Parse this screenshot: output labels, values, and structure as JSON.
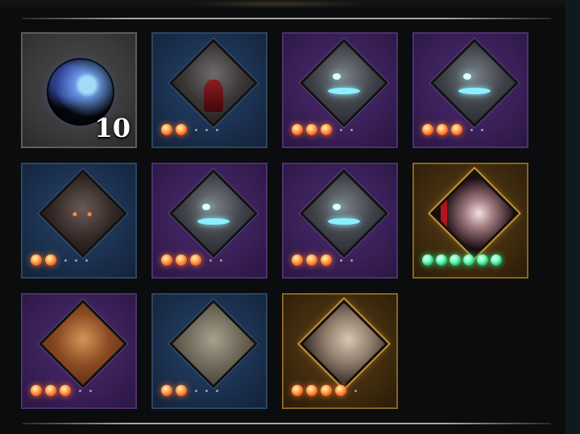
{
  "item": {
    "name_icon": "dark-blue-orb-icon",
    "quantity": "10"
  },
  "characters": [
    {
      "slot": 2,
      "frame": "blue",
      "portrait": "hooded-figure-portrait",
      "stars": 2,
      "star_color": "fire",
      "max_stars": 5
    },
    {
      "slot": 3,
      "frame": "purple",
      "portrait": "masked-figure-portrait",
      "stars": 3,
      "star_color": "fire",
      "max_stars": 5
    },
    {
      "slot": 4,
      "frame": "purple",
      "portrait": "masked-figure-portrait",
      "stars": 3,
      "star_color": "fire",
      "max_stars": 5
    },
    {
      "slot": 5,
      "frame": "blue",
      "portrait": "demon-faced-portrait",
      "stars": 2,
      "star_color": "fire",
      "max_stars": 5
    },
    {
      "slot": 6,
      "frame": "purple",
      "portrait": "masked-figure-portrait",
      "stars": 3,
      "star_color": "fire",
      "max_stars": 5
    },
    {
      "slot": 7,
      "frame": "purple",
      "portrait": "masked-figure-portrait",
      "stars": 3,
      "star_color": "fire",
      "max_stars": 5
    },
    {
      "slot": 8,
      "frame": "gold",
      "portrait": "dark-haired-woman-portrait",
      "stars": 6,
      "star_color": "green",
      "max_stars": 6
    },
    {
      "slot": 9,
      "frame": "purple",
      "portrait": "grinning-warrior-portrait",
      "stars": 3,
      "star_color": "fire",
      "max_stars": 5
    },
    {
      "slot": 10,
      "frame": "blue",
      "portrait": "old-man-portrait",
      "stars": 2,
      "star_color": "fire",
      "max_stars": 5
    },
    {
      "slot": 11,
      "frame": "gold",
      "portrait": "noble-man-portrait",
      "stars": 4,
      "star_color": "fire",
      "max_stars": 5
    }
  ],
  "colors": {
    "blue_frame": "#1b3150",
    "purple_frame": "#3a2058",
    "gold_frame": "#3e2a0e",
    "gray_frame": "#3a3a3a",
    "fire_star": "#ff5a1f",
    "green_star": "#19c26a"
  }
}
